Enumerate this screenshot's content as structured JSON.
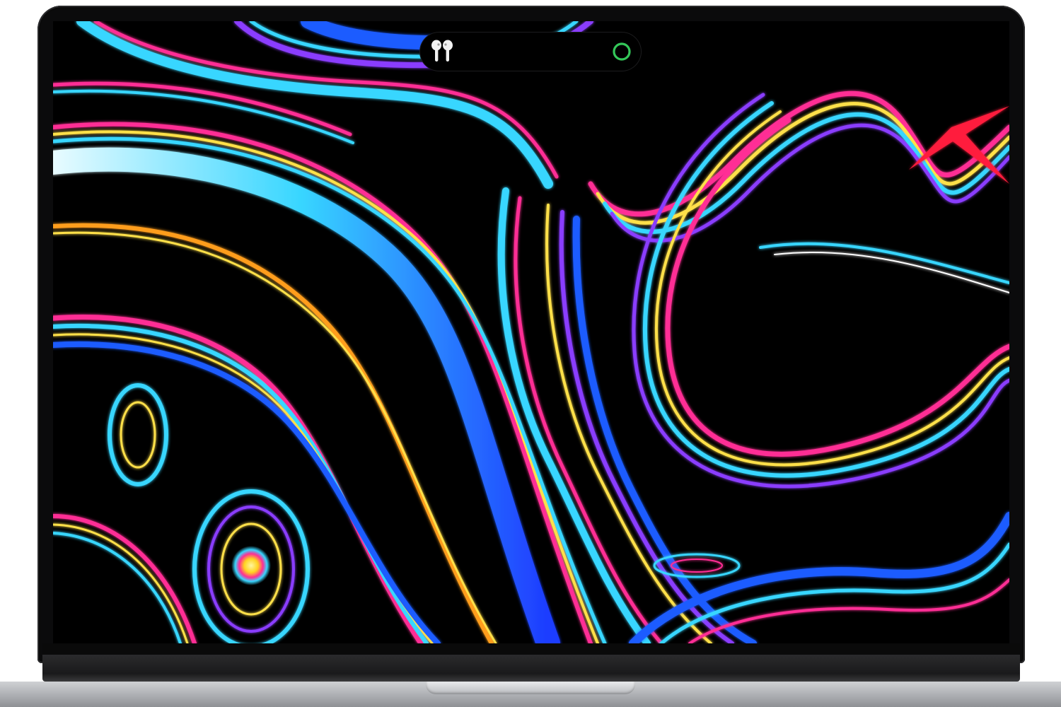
{
  "device": {
    "type": "laptop",
    "wallpaper": "abstract-fluid-wallpaper",
    "bezel_color": "#0b0b0c",
    "base_color": "#b8babe"
  },
  "status_pill": {
    "left_icon": "airpods-icon",
    "right_icon": "status-ring-icon",
    "ring_color": "#34c759"
  },
  "colors": {
    "magenta": "#ff2d95",
    "yellow": "#ffe04a",
    "cyan": "#38d6ff",
    "blue": "#1e5bff",
    "purple": "#8a3cff",
    "orange": "#ff9d1f",
    "red": "#ff1f3d"
  }
}
